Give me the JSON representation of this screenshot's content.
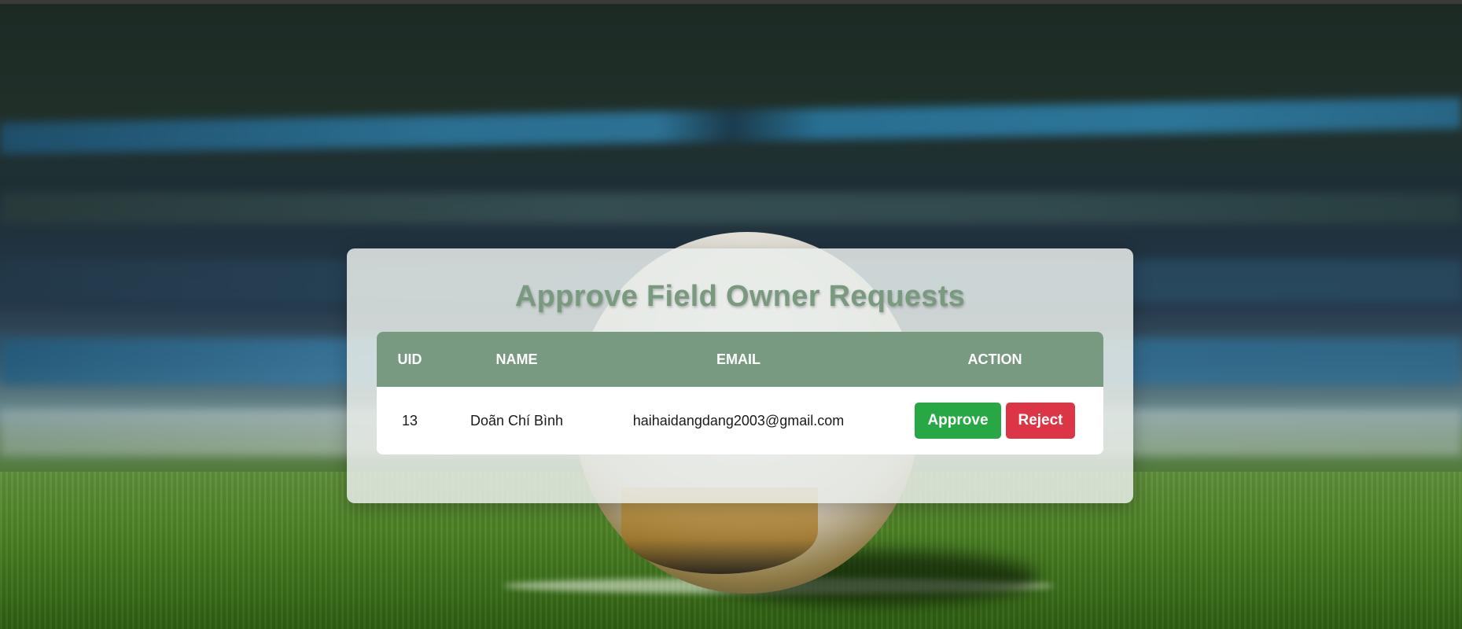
{
  "page": {
    "title": "Approve Field Owner Requests"
  },
  "table": {
    "headers": {
      "uid": "UID",
      "name": "NAME",
      "email": "EMAIL",
      "action": "ACTION"
    },
    "rows": [
      {
        "uid": "13",
        "name": "Doãn Chí Bình",
        "email": "haihaidangdang2003@gmail.com",
        "approve_label": "Approve",
        "reject_label": "Reject"
      }
    ]
  },
  "colors": {
    "header_bg": "#779a80",
    "title": "#7a9a80",
    "approve": "#28a745",
    "reject": "#dc3545"
  }
}
